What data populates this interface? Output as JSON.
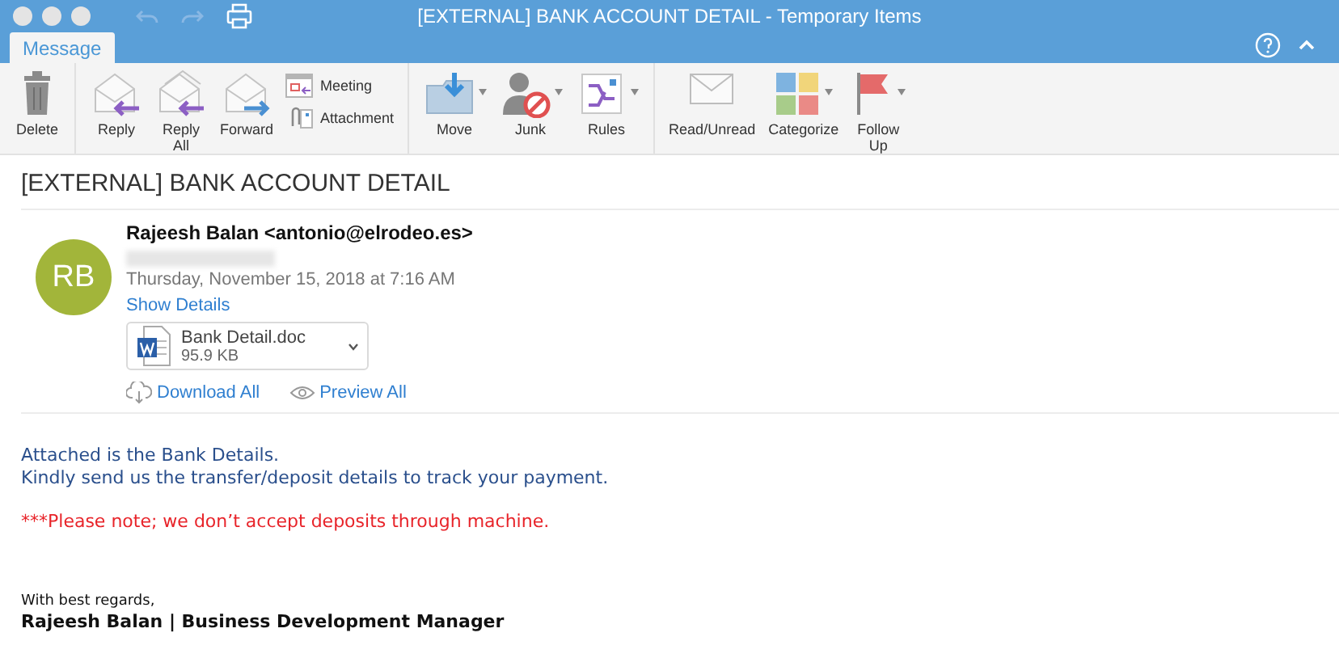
{
  "window": {
    "title": "[EXTERNAL] BANK ACCOUNT DETAIL - Temporary Items"
  },
  "tabs": [
    {
      "label": "Message",
      "selected": true
    }
  ],
  "ribbon": [
    {
      "items": [
        {
          "kind": "large",
          "label": "Delete",
          "dropdown": false
        }
      ]
    },
    {
      "items": [
        {
          "kind": "large",
          "label": "Reply",
          "dropdown": false
        },
        {
          "kind": "large",
          "label": "Reply All",
          "dropdown": false
        },
        {
          "kind": "large",
          "label": "Forward",
          "dropdown": false
        },
        {
          "kind": "stack",
          "entries": [
            {
              "label": "Meeting"
            },
            {
              "label": "Attachment"
            }
          ]
        }
      ]
    },
    {
      "items": [
        {
          "kind": "large",
          "label": "Move",
          "dropdown": true
        },
        {
          "kind": "large",
          "label": "Junk",
          "dropdown": true
        },
        {
          "kind": "large",
          "label": "Rules",
          "dropdown": true
        }
      ]
    },
    {
      "items": [
        {
          "kind": "large",
          "label": "Read/Unread",
          "dropdown": false
        },
        {
          "kind": "large",
          "label": "Categorize",
          "dropdown": true
        },
        {
          "kind": "large",
          "label": "Follow Up",
          "dropdown": true
        }
      ]
    }
  ],
  "message": {
    "subject": "[EXTERNAL] BANK ACCOUNT DETAIL",
    "avatar": {
      "initials": "RB",
      "color": "#a2b53a"
    },
    "sender": "Rajeesh Balan <antonio@elrodeo.es>",
    "recipient": {
      "redacted": true
    },
    "date": "Thursday, November 15, 2018 at 7:16 AM",
    "details_link": "Show Details",
    "attachments": [
      {
        "name": "Bank Detail.doc",
        "size": "95.9 KB"
      }
    ],
    "actions": [
      {
        "label": "Download All"
      },
      {
        "label": "Preview All"
      }
    ],
    "body": [
      {
        "kind": "note",
        "lines": [
          "Attached is the Bank Details.",
          "Kindly send us the transfer/deposit details to track your payment."
        ]
      },
      {
        "kind": "warning",
        "lines": [
          "***Please note; we don’t accept deposits through machine."
        ]
      },
      {
        "kind": "signature",
        "lines": [
          "With best regards,",
          "Rajeesh Balan | Business Development Manager"
        ]
      }
    ]
  }
}
